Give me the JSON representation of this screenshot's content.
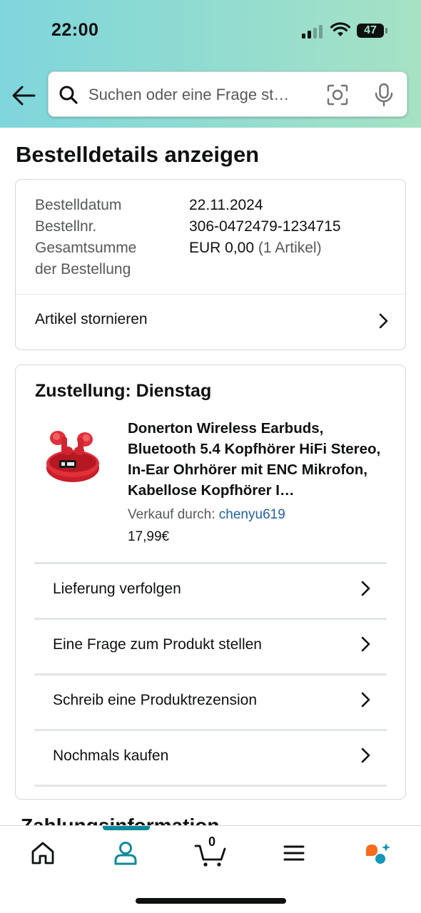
{
  "status_bar": {
    "time": "22:00",
    "battery": "47"
  },
  "search": {
    "placeholder": "Suchen oder eine Frage st…"
  },
  "page": {
    "title": "Bestelldetails anzeigen"
  },
  "order": {
    "date_label": "Bestelldatum",
    "date_value": "22.11.2024",
    "number_label": "Bestellnr.",
    "number_value": "306-0472479-1234715",
    "total_label_1": "Gesamtsumme",
    "total_label_2": "der Bestellung",
    "total_value": "EUR 0,00",
    "total_items": "(1 Artikel)",
    "cancel_label": "Artikel stornieren"
  },
  "shipment": {
    "title": "Zustellung: Dienstag",
    "product_title": "Donerton Wireless Earbuds, Bluetooth 5.4 Kopfhörer HiFi Stereo, In-Ear Ohrhörer mit ENC Mikrofon, Kabellose Kopfhörer I…",
    "seller_prefix": "Verkauf durch: ",
    "seller_name": "chenyu619",
    "price": "17,99€",
    "actions": [
      {
        "label": "Lieferung verfolgen"
      },
      {
        "label": "Eine Frage zum Produkt stellen"
      },
      {
        "label": "Schreib eine Produktrezension"
      },
      {
        "label": "Nochmals kaufen"
      }
    ]
  },
  "next_section": {
    "title": "Zahlungsinformation"
  },
  "bottom_nav": {
    "cart_count": "0",
    "items": [
      "home-icon",
      "account-icon",
      "cart-icon",
      "menu-icon",
      "rufus-ai-icon"
    ],
    "active": "account-icon"
  },
  "colors": {
    "accent": "#0f8a9a",
    "link": "#2162a1",
    "product_red": "#d9232e"
  }
}
